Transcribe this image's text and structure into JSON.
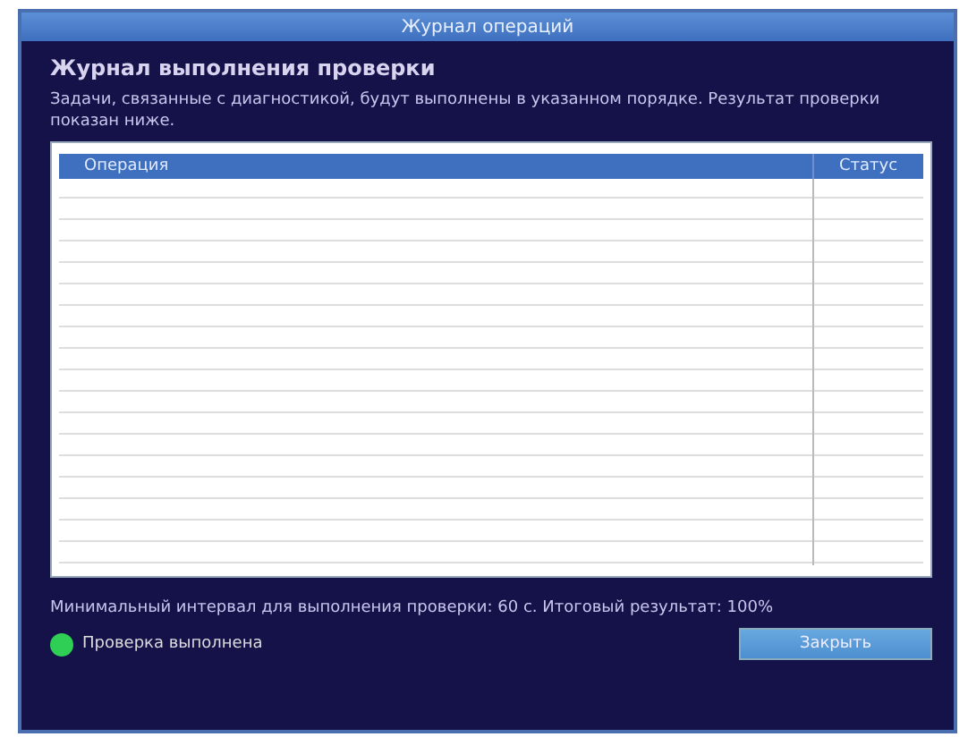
{
  "window": {
    "title": "Журнал операций"
  },
  "heading": "Журнал выполнения проверки",
  "description": "Задачи, связанные с диагностикой, будут выполнены в указанном порядке. Результат проверки показан ниже.",
  "table": {
    "columns": [
      "Операция",
      "Статус"
    ]
  },
  "summary": "Минимальный интервал для выполнения проверки: 60 с. Итоговый результат: 100%",
  "status": {
    "text": "Проверка выполнена",
    "ok": true
  },
  "buttons": [
    "Закрыть"
  ]
}
